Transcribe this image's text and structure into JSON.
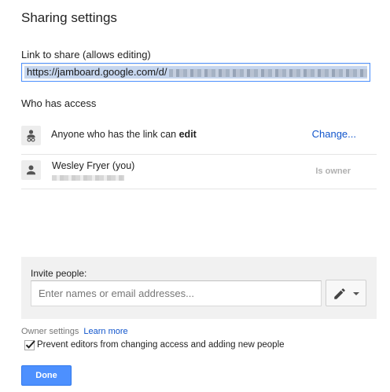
{
  "dialog": {
    "title": "Sharing settings"
  },
  "link": {
    "label": "Link to share (allows editing)",
    "url_visible": "https://jamboard.google.com/d/"
  },
  "access": {
    "label": "Who has access",
    "rows": [
      {
        "icon": "link-person-icon",
        "text_pre": "Anyone who has the link can ",
        "text_bold": "edit",
        "action": "Change..."
      },
      {
        "icon": "person-icon",
        "name": "Wesley Fryer (you)",
        "role": "Is owner"
      }
    ]
  },
  "invite": {
    "label": "Invite people:",
    "placeholder": "Enter names or email addresses...",
    "permission_icon": "pencil-icon"
  },
  "owner_settings": {
    "label": "Owner settings",
    "learn_more": "Learn more",
    "prevent_checkbox": {
      "label": "Prevent editors from changing access and adding new people",
      "checked": true
    }
  },
  "buttons": {
    "done": "Done"
  },
  "colors": {
    "accent": "#4d90fe",
    "link": "#1155cc",
    "panel": "#f1f1f1"
  }
}
